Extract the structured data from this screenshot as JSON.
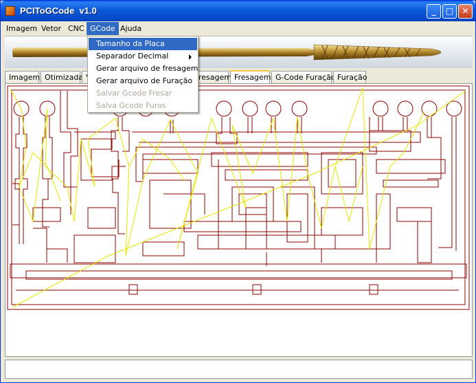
{
  "window": {
    "title": "PCIToGCode  v1.0"
  },
  "titlebar_buttons": {
    "minimize": "_",
    "maximize": "□",
    "close": "✕"
  },
  "menu": [
    {
      "label": "Imagem"
    },
    {
      "label": "Vetor"
    },
    {
      "label": "CNC"
    },
    {
      "label": "GCode"
    },
    {
      "label": "Ajuda"
    }
  ],
  "gcode_menu": {
    "items": [
      {
        "label": "Tamanho da Placa",
        "state": "highlighted"
      },
      {
        "label": "Separador Decimal",
        "state": "submenu"
      },
      {
        "label": "Gerar arquivo de fresagem",
        "state": "normal"
      },
      {
        "label": "Gerar arquivo de Furação",
        "state": "normal"
      },
      {
        "label": "Salvar Gcode Fresar",
        "state": "disabled"
      },
      {
        "label": "Salva Gcode Furos",
        "state": "disabled"
      }
    ]
  },
  "tabs": [
    {
      "label": "Imagem"
    },
    {
      "label": "Otimizada"
    },
    {
      "label": "V"
    },
    {
      "label": "resagem"
    },
    {
      "label": "Fresagem",
      "selected": true
    },
    {
      "label": "G-Code Furação"
    },
    {
      "label": "Furação"
    }
  ],
  "colors": {
    "trace": "#8b0000",
    "path": "#e6e600",
    "menu_highlight": "#316ac5",
    "titlebar": "#0b5ad9"
  },
  "icons": {
    "app": "app-icon",
    "banner": "drill-bit-banner"
  }
}
